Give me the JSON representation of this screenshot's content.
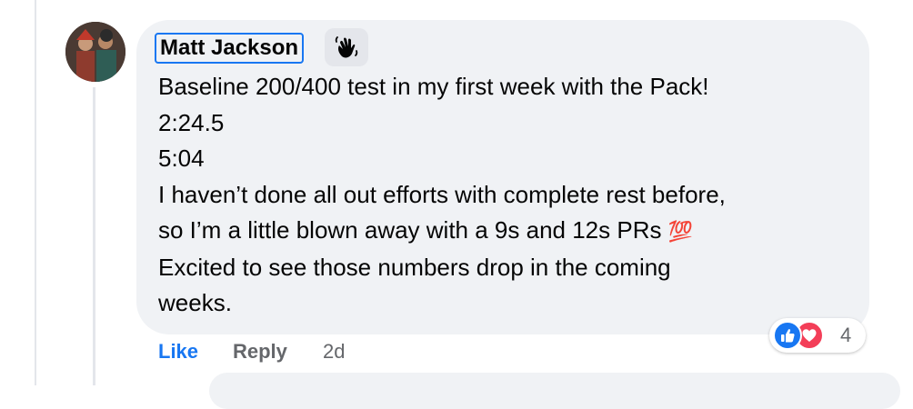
{
  "comment": {
    "author": "Matt Jackson",
    "badge_icon": "waving-hand-icon",
    "lines": [
      "Baseline 200/400 test in my first week with the Pack!",
      "2:24.5",
      "5:04",
      "I haven’t done all out efforts with complete rest before,",
      "so I’m a little blown away with a 9s and 12s PRs",
      "Excited to see those numbers drop in the coming",
      "weeks."
    ],
    "emoji": "💯"
  },
  "actions": {
    "like_label": "Like",
    "reply_label": "Reply",
    "timestamp": "2d"
  },
  "reactions": {
    "icons": [
      "like-reaction-icon",
      "love-reaction-icon"
    ],
    "count": "4"
  },
  "colors": {
    "bubble": "#f0f2f5",
    "accent": "#1877f2",
    "love": "#f33e58",
    "muted": "#65676b"
  }
}
